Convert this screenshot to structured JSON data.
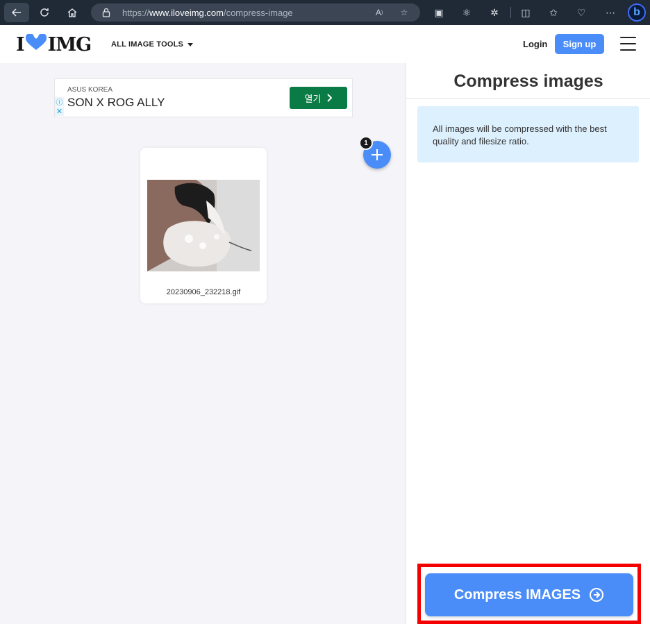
{
  "browser": {
    "url_prefix": "https://",
    "url_domain": "www.iloveimg.com",
    "url_path": "/compress-image"
  },
  "header": {
    "logo_left": "I",
    "logo_right": "IMG",
    "tools_menu": "ALL IMAGE TOOLS",
    "login": "Login",
    "signup": "Sign up"
  },
  "ad": {
    "brand": "ASUS KOREA",
    "title": "SON X ROG ALLY",
    "open_label": "열기"
  },
  "file": {
    "name": "20230906_232218.gif",
    "count": "1"
  },
  "sidebar": {
    "title": "Compress images",
    "info": "All images will be compressed with the best quality and filesize ratio.",
    "compress_label": "Compress IMAGES"
  },
  "colors": {
    "accent": "#4b8df8",
    "highlight": "#f40000",
    "ad_button": "#0b7b45",
    "info_bg": "#ddf0fd"
  }
}
